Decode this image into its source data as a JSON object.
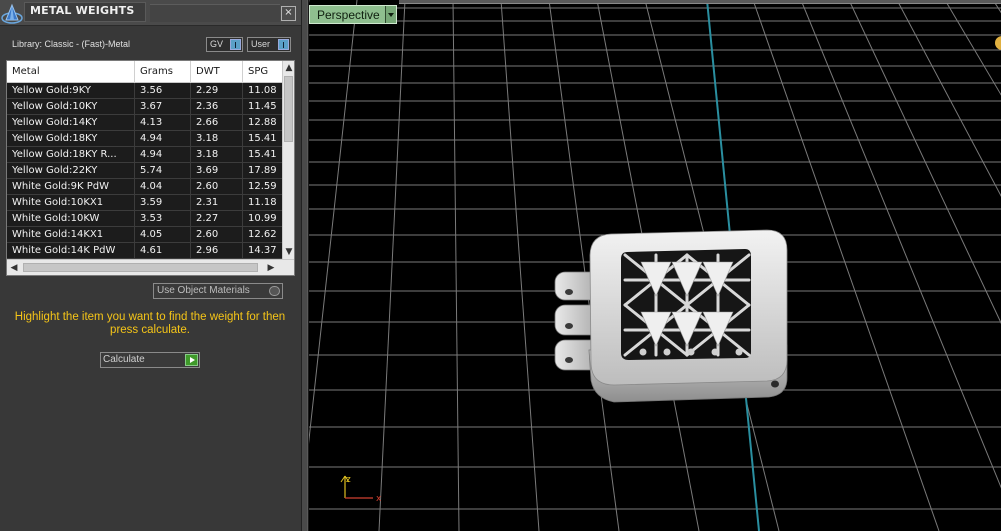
{
  "window": {
    "title": "METAL WEIGHTS",
    "close_glyph": "×"
  },
  "library": {
    "label": "Library: Classic - (Fast)-Metal",
    "gv_label": "GV",
    "user_label": "User"
  },
  "table": {
    "columns": [
      "Metal",
      "Grams",
      "DWT",
      "SPG"
    ],
    "rows": [
      [
        "Yellow Gold:9KY",
        "3.56",
        "2.29",
        "11.08"
      ],
      [
        "Yellow Gold:10KY",
        "3.67",
        "2.36",
        "11.45"
      ],
      [
        "Yellow Gold:14KY",
        "4.13",
        "2.66",
        "12.88"
      ],
      [
        "Yellow Gold:18KY",
        "4.94",
        "3.18",
        "15.41"
      ],
      [
        "Yellow Gold:18KY R...",
        "4.94",
        "3.18",
        "15.41"
      ],
      [
        "Yellow Gold:22KY",
        "5.74",
        "3.69",
        "17.89"
      ],
      [
        "White Gold:9K PdW",
        "4.04",
        "2.60",
        "12.59"
      ],
      [
        "White Gold:10KX1",
        "3.59",
        "2.31",
        "11.18"
      ],
      [
        "White Gold:10KW",
        "3.53",
        "2.27",
        "10.99"
      ],
      [
        "White Gold:14KX1",
        "4.05",
        "2.60",
        "12.62"
      ],
      [
        "White Gold:14K PdW",
        "4.61",
        "2.96",
        "14.37"
      ]
    ]
  },
  "controls": {
    "use_object_materials": "Use Object Materials",
    "hint": "Highlight the item you want to find the weight for then press calculate.",
    "calculate": "Calculate"
  },
  "viewport": {
    "view_mode": "Perspective",
    "axis_x": "x",
    "axis_z": "z"
  },
  "icons": {
    "logo": "app-logo-icon",
    "close": "close-icon",
    "calculate": "play-icon",
    "dropdown": "chevron-down-icon"
  },
  "colors": {
    "hint_text": "#f5c518",
    "perspective_button": "#8fbf8f",
    "grid_line": "#7a7a7a",
    "axis_line": "#2a8fa0",
    "calculate_icon": "#3f9a2a"
  }
}
